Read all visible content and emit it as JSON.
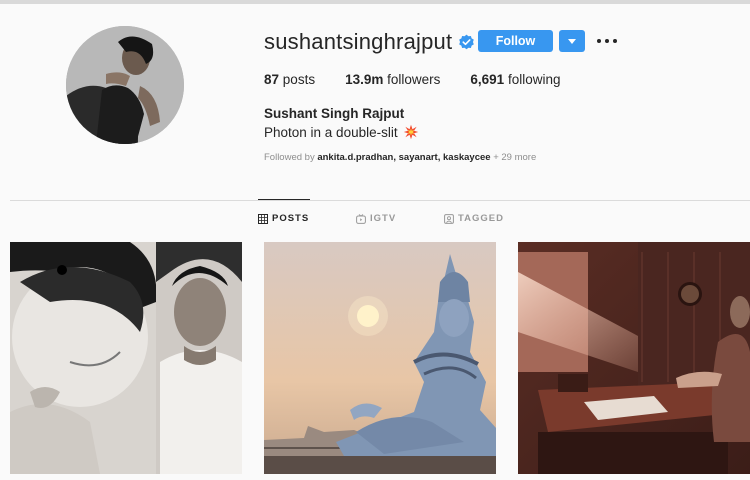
{
  "profile": {
    "username": "sushantsinghrajput",
    "verified": true,
    "follow_label": "Follow",
    "stats": {
      "posts_count": "87",
      "posts_label": "posts",
      "followers_count": "13.9m",
      "followers_label": "followers",
      "following_count": "6,691",
      "following_label": "following"
    },
    "full_name": "Sushant Singh Rajput",
    "bio": "Photon in a double-slit",
    "followed_by": {
      "prefix": "Followed by",
      "users": "ankita.d.pradhan, sayanart, kaskaycee",
      "suffix": "+ 29 more"
    }
  },
  "tabs": [
    {
      "label": "POSTS",
      "icon": "grid-icon",
      "active": true
    },
    {
      "label": "IGTV",
      "icon": "igtv-icon",
      "active": false
    },
    {
      "label": "TAGGED",
      "icon": "tag-icon",
      "active": false
    }
  ],
  "colors": {
    "accent": "#3897f0",
    "verified": "#3897f0",
    "text": "#262626",
    "muted": "#8e8e8e",
    "background": "#fafafa"
  }
}
